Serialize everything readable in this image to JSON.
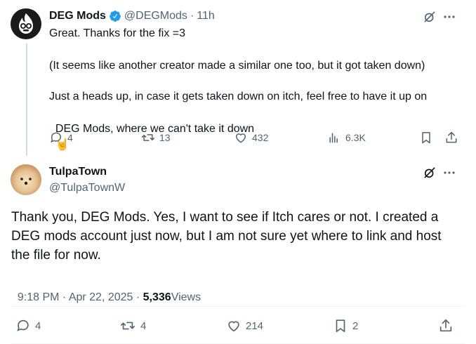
{
  "tweet1": {
    "author": "DEG Mods",
    "handle": "@DEGMods",
    "separator": "·",
    "time": "11h",
    "lines": [
      "Great. Thanks for the fix =3",
      "(It seems like another creator made a similar one too, but it got taken down)",
      "Just a heads up, in case it gets taken down on itch, feel free to have it up on",
      "DEG Mods, where we can't take it down"
    ],
    "emoji": "🤘",
    "replies": "4",
    "reposts": "13",
    "likes": "432",
    "views": "6.3K"
  },
  "tweet2": {
    "author": "TulpaTown",
    "handle": "@TulpaTownW",
    "lines": [
      "Thank you, DEG Mods. Yes, I want to see if Itch cares or not. I created a",
      "DEG mods account just now, but I am not sure yet where to link and host",
      "the file for now."
    ],
    "timestamp": "9:18 PM · Apr 22, 2025 · ",
    "view_count": "5,336",
    "views_label": "Views",
    "replies": "4",
    "reposts": "4",
    "likes": "214",
    "bookmarks": "2"
  },
  "colors": {
    "verified": "#1d9bf0",
    "muted": "#536471",
    "text": "#0f1419",
    "thread_line": "#cfd9de"
  }
}
